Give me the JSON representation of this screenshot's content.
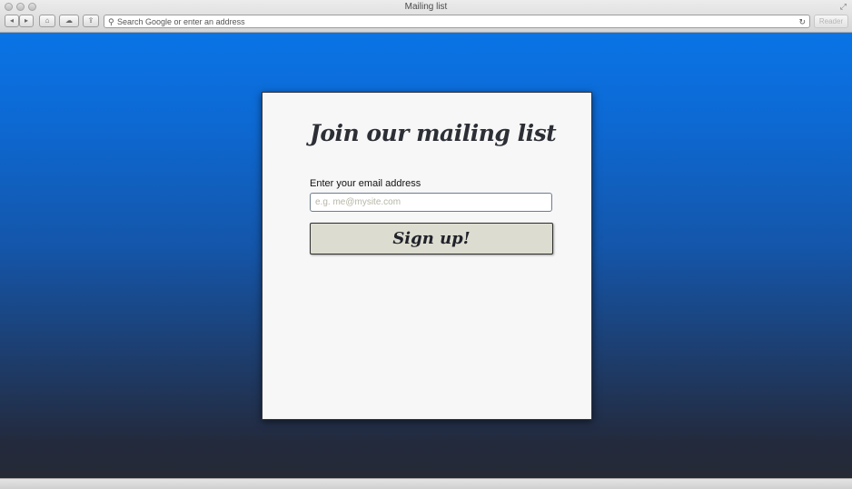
{
  "window": {
    "title": "Mailing list"
  },
  "toolbar": {
    "back_icon": "◂",
    "forward_icon": "▸",
    "home_icon": "⌂",
    "icloud_icon": "☁",
    "share_icon": "⇪",
    "search_icon": "⚲",
    "reload_icon": "↻",
    "fullscreen_icon": "⤢",
    "address_placeholder": "Search Google or enter an address",
    "reader_label": "Reader"
  },
  "form": {
    "title": "Join our mailing list",
    "email_label": "Enter your email address",
    "email_placeholder": "e.g. me@mysite.com",
    "email_value": "",
    "submit_label": "Sign up!"
  },
  "colors": {
    "background_top": "#0a74e6",
    "background_bottom": "#252a35",
    "card": "#f7f7f7",
    "button": "#dcdcd0",
    "title_text": "#2d2f36"
  }
}
